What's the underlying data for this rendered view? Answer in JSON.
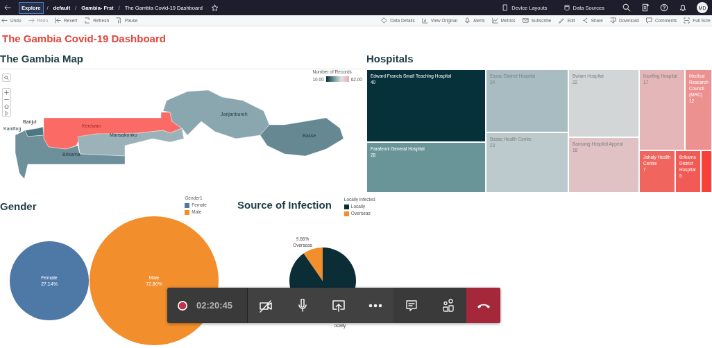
{
  "topbar": {
    "breadcrumbs": [
      {
        "label": "Explore",
        "focused": true,
        "separator": "/"
      },
      {
        "label": "default",
        "focused": false,
        "separator": "/"
      },
      {
        "label": "Gambia- Frst",
        "focused": false,
        "separator": "/"
      },
      {
        "label": "The Gambia Covid-19 Dashboard",
        "focused": false
      }
    ],
    "links": [
      {
        "label": "Device Layouts"
      },
      {
        "label": "Data Sources"
      }
    ],
    "avatar": "MD"
  },
  "toolbar": {
    "left": [
      {
        "label": "Undo",
        "disabled": false
      },
      {
        "label": "Redo",
        "disabled": true
      },
      {
        "label": "Revert",
        "disabled": false
      },
      {
        "label": "Refresh",
        "disabled": false
      },
      {
        "label": "Pause",
        "disabled": false
      }
    ],
    "right": [
      {
        "label": "Data Details",
        "disabled": false
      },
      {
        "label": "View Original",
        "disabled": false
      },
      {
        "label": "Alerts",
        "disabled": false
      },
      {
        "label": "Metrics",
        "disabled": false
      },
      {
        "label": "Subscribe",
        "disabled": false
      },
      {
        "label": "Edit",
        "disabled": false
      },
      {
        "label": "Share",
        "disabled": false
      },
      {
        "label": "Download",
        "disabled": false
      },
      {
        "label": "Comments",
        "disabled": false
      },
      {
        "label": "Full Scre",
        "disabled": false
      }
    ]
  },
  "title": "The Gambia Covid-19 Dashboard",
  "map": {
    "heading": "The Gambia Map",
    "legend": {
      "title": "Number of Records",
      "min": "10.00",
      "max": "62.00"
    },
    "regions": [
      {
        "name": "Banjul"
      },
      {
        "name": "Kanifing",
        "color": "#4f7783"
      },
      {
        "name": "Kerewan",
        "color": "#fb6a64"
      },
      {
        "name": "Mansakonko",
        "color": "#9bb2b8"
      },
      {
        "name": "Brikama",
        "color": "#6d909a"
      },
      {
        "name": "Janjanbureh",
        "color": "#8aa7b0"
      },
      {
        "name": "Basse",
        "color": "#668893"
      }
    ]
  },
  "hospitals": {
    "heading": "Hospitals",
    "cells": [
      {
        "name": "Edward Francis Small Teaching Hospital",
        "value": "40",
        "color": "#06303a"
      },
      {
        "name": "Farafenni General Hospital",
        "value": "28",
        "color": "#6a9598"
      },
      {
        "name": "Essau District Hospital",
        "value": "24",
        "color": "#a9bcc1"
      },
      {
        "name": "Basse Health Centre",
        "value": "23",
        "color": "#bccacd"
      },
      {
        "name": "Bwiam Hospital",
        "value": "22",
        "color": "#d2d6d6"
      },
      {
        "name": "Bansang Hospital Appeal",
        "value": "18",
        "color": "#e0c1c4"
      },
      {
        "name": "Kanifing Hospital",
        "value": "17",
        "color": "#e5b6b8"
      },
      {
        "name": "Medical Research Council (MRC)",
        "value": "12",
        "color": "#ec9090"
      },
      {
        "name": "Jahaly Health Centre",
        "value": "7",
        "color": "#f0665f"
      },
      {
        "name": "Brikama District Hospital",
        "value": "5",
        "color": "#f25b55"
      },
      {
        "color": "#f74038"
      }
    ]
  },
  "gender": {
    "heading": "Gender",
    "legend_title": "Gender1",
    "legend": [
      {
        "label": "Female",
        "color": "#4e79a7"
      },
      {
        "label": "Male",
        "color": "#f28e2b"
      }
    ],
    "bubbles": [
      {
        "label": "Female",
        "share": "27.14%"
      },
      {
        "label": "Male",
        "share": "72.86%"
      }
    ]
  },
  "infection": {
    "heading": "Source of Infection",
    "legend_title": "Locally infected",
    "legend": [
      {
        "label": "Locally",
        "color": "#0b2e36"
      },
      {
        "label": "Overseas",
        "color": "#f28e2b"
      }
    ],
    "slice_label": {
      "share": "9.66%",
      "label": "Overseas"
    },
    "bottom_label": "ocally"
  },
  "call": {
    "recording": true,
    "timer": "02:20:45",
    "video_on": false,
    "mic_on": true
  }
}
